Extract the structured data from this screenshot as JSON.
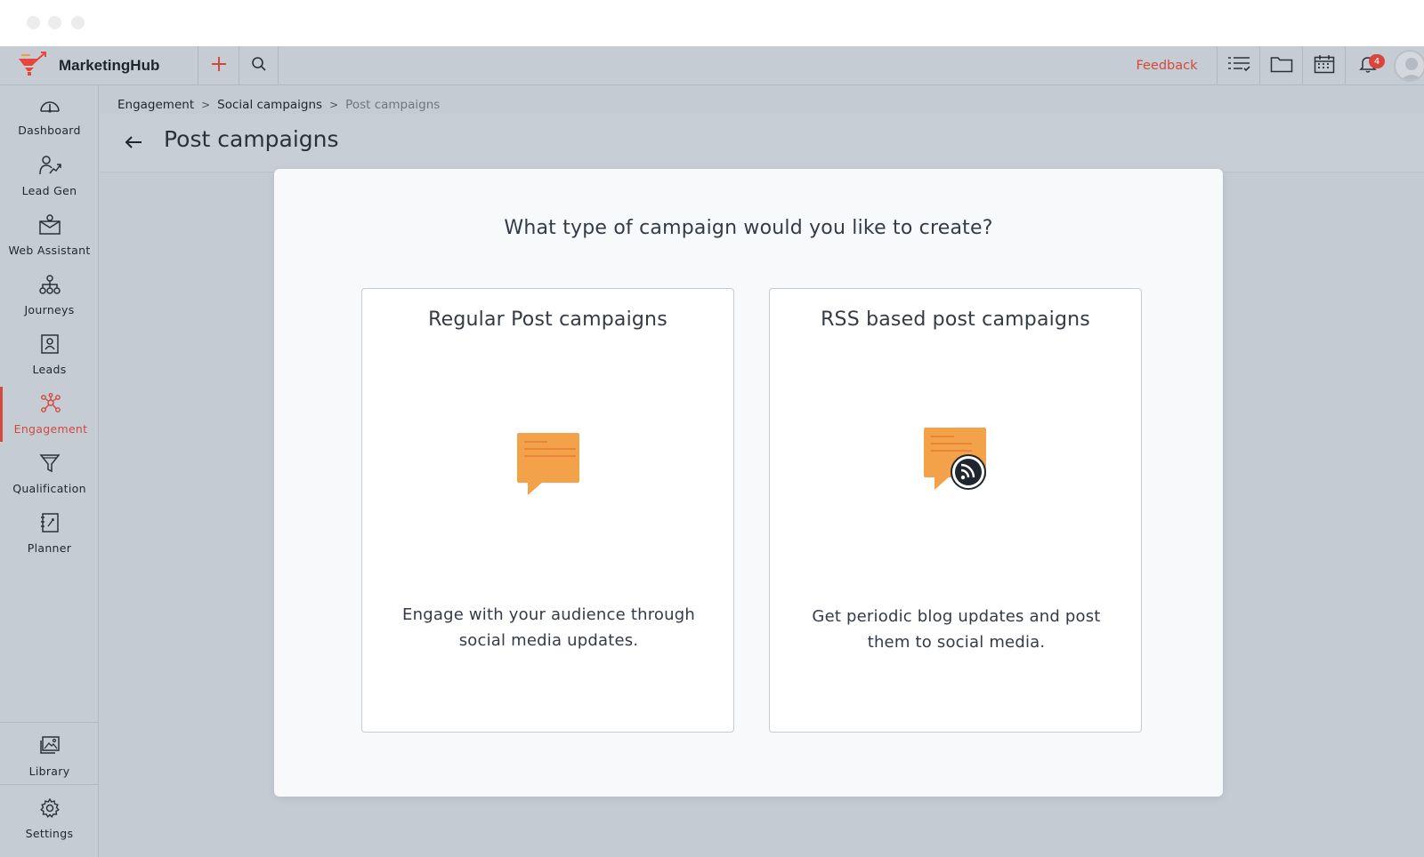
{
  "app": {
    "name": "MarketingHub"
  },
  "topbar": {
    "feedback_label": "Feedback",
    "notification_count": "4"
  },
  "sidebar": {
    "items": [
      {
        "label": "Dashboard",
        "icon": "dashboard-icon"
      },
      {
        "label": "Lead Gen",
        "icon": "lead-gen-icon"
      },
      {
        "label": "Web Assistant",
        "icon": "web-assistant-icon"
      },
      {
        "label": "Journeys",
        "icon": "journeys-icon"
      },
      {
        "label": "Leads",
        "icon": "leads-icon"
      },
      {
        "label": "Engagement",
        "icon": "engagement-icon",
        "active": true
      },
      {
        "label": "Qualification",
        "icon": "funnel-icon"
      },
      {
        "label": "Planner",
        "icon": "planner-icon"
      }
    ],
    "bottom_items": [
      {
        "label": "Library",
        "icon": "library-icon"
      },
      {
        "label": "Settings",
        "icon": "gear-icon"
      }
    ]
  },
  "breadcrumb": {
    "items": [
      "Engagement",
      "Social campaigns",
      "Post campaigns"
    ],
    "separator": ">"
  },
  "page": {
    "title": "Post campaigns"
  },
  "modal": {
    "question": "What type of campaign would you like to create?",
    "cards": [
      {
        "title": "Regular Post campaigns",
        "description": "Engage with your audience through social media updates.",
        "icon": "chat-bubble-icon"
      },
      {
        "title": "RSS based post campaigns",
        "description": "Get periodic blog updates and post them to social media.",
        "icon": "rss-chat-bubble-icon"
      }
    ]
  },
  "colors": {
    "accent": "#d24a3c",
    "icon_orange": "#f4a24a",
    "background_overlay": "#c5cbd3"
  }
}
